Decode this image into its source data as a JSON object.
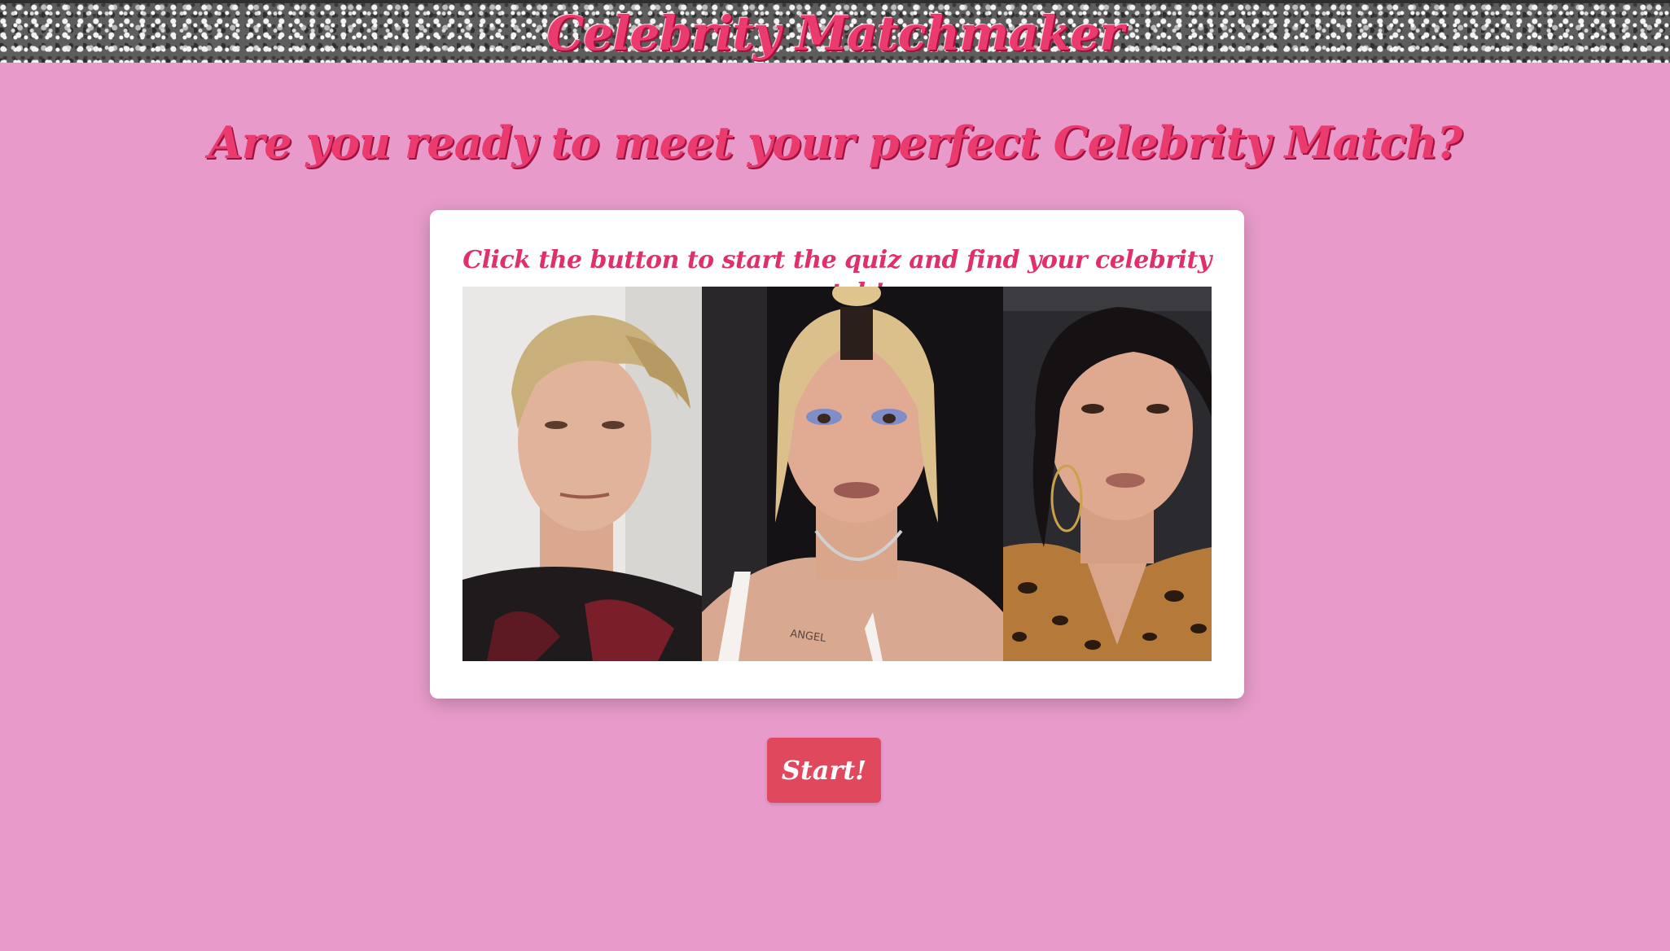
{
  "header": {
    "title": "Celebrity Matchmaker"
  },
  "main": {
    "headline": "Are you ready to meet your perfect Celebrity Match?",
    "card_text": "Click the button to start the quiz and find your celebrity match!",
    "start_label": "Start!"
  },
  "photos": [
    {
      "name": "celebrity-photo-1"
    },
    {
      "name": "celebrity-photo-2",
      "tattoo_text": "ANGEL"
    },
    {
      "name": "celebrity-photo-3"
    }
  ],
  "colors": {
    "background": "#e89bca",
    "title": "#ea3a6e",
    "button": "#e0485e",
    "card": "#ffffff"
  }
}
